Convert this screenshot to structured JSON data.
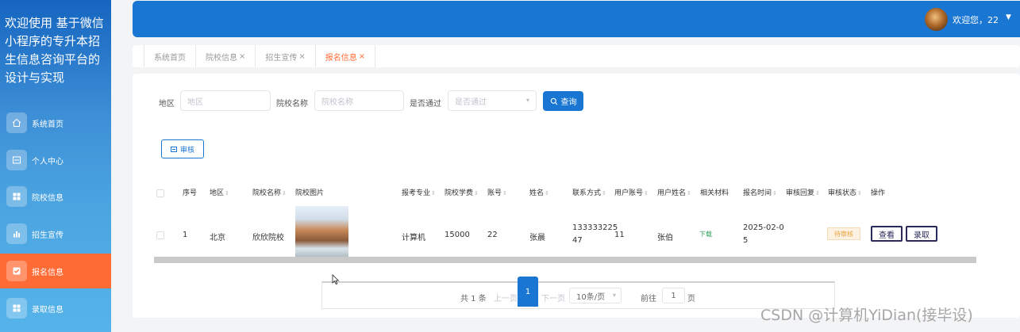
{
  "app": {
    "title": "欢迎使用 基于微信小程序的专升本招生信息咨询平台的设计与实现"
  },
  "sidebar": {
    "items": [
      {
        "label": "系统首页",
        "icon": "home-icon"
      },
      {
        "label": "个人中心",
        "icon": "user-card-icon"
      },
      {
        "label": "院校信息",
        "icon": "grid-icon"
      },
      {
        "label": "招生宣传",
        "icon": "bar-chart-icon"
      },
      {
        "label": "报名信息",
        "icon": "checkbox-icon",
        "active": true
      },
      {
        "label": "录取信息",
        "icon": "grid-icon"
      }
    ]
  },
  "header": {
    "welcome": "欢迎您，22",
    "caret": "▼"
  },
  "tabs": [
    {
      "label": "系统首页",
      "close": ""
    },
    {
      "label": "院校信息",
      "close": "×"
    },
    {
      "label": "招生宣传",
      "close": "×"
    },
    {
      "label": "报名信息",
      "close": "×",
      "active": true
    }
  ],
  "filters": {
    "region_label": "地区",
    "region_placeholder": "地区",
    "school_label": "院校名称",
    "school_placeholder": "院校名称",
    "pass_label": "是否通过",
    "pass_placeholder": "是否通过",
    "query_button": "查询",
    "review_button": "审核"
  },
  "table": {
    "headers": [
      "序号",
      "地区",
      "院校名称",
      "院校图片",
      "报考专业",
      "院校学费",
      "账号",
      "姓名",
      "联系方式",
      "用户账号",
      "用户姓名",
      "相关材料",
      "报名时间",
      "审核回复",
      "审核状态",
      "操作"
    ],
    "rows": [
      {
        "index": "1",
        "region": "北京",
        "school": "欣欣院校",
        "major": "计算机",
        "tuition": "15000",
        "account": "22",
        "name": "张晨",
        "phone_line1": "133333225",
        "phone_line2": "47",
        "user_account": "11",
        "user_name": "张伯",
        "material": "下载",
        "time_line1": "2025-02-0",
        "time_line2": "5",
        "status": "待审核",
        "view_button": "查看",
        "admit_button": "录取"
      }
    ]
  },
  "pagination": {
    "total": "共 1 条",
    "prev": "上一页",
    "current": "1",
    "next": "下一页",
    "page_size": "10条/页",
    "goto_label": "前往",
    "goto_value": "1",
    "page_suffix": "页"
  },
  "watermark": "CSDN @计算机YiDian(接毕设)",
  "colors": {
    "primary": "#1976d2",
    "accent": "#ff6b35",
    "status_pending": "#e6a23c",
    "download": "#2e9e5b"
  }
}
